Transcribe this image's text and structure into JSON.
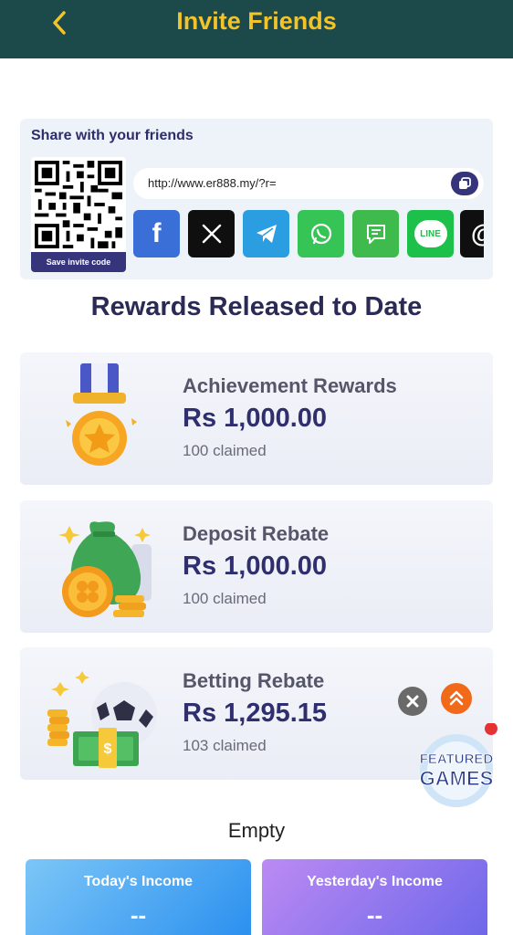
{
  "header": {
    "title": "Invite Friends"
  },
  "share": {
    "title": "Share with your friends",
    "save_label": "Save invite code",
    "invite_url": "http://www.er888.my/?r=",
    "platforms": [
      {
        "name": "Facebook",
        "glyph": "f",
        "color": "#3b6fd8"
      },
      {
        "name": "X",
        "glyph": "𝕏",
        "color": "#0f0f0f"
      },
      {
        "name": "Telegram",
        "glyph": "",
        "color": "#2a9ee0"
      },
      {
        "name": "WhatsApp",
        "glyph": "",
        "color": "#37c456"
      },
      {
        "name": "SMS",
        "glyph": "",
        "color": "#3fbb4d"
      },
      {
        "name": "LINE",
        "glyph": "LINE",
        "color": "#1cc04a"
      },
      {
        "name": "Threads",
        "glyph": "@",
        "color": "#0f0f0f"
      }
    ]
  },
  "rewards": {
    "section_title": "Rewards Released to Date",
    "items": [
      {
        "name": "Achievement Rewards",
        "amount": "Rs  1,000.00",
        "claimed": "100 claimed",
        "icon": "medal-icon"
      },
      {
        "name": "Deposit Rebate",
        "amount": "Rs  1,000.00",
        "claimed": "100 claimed",
        "icon": "money-bag-icon"
      },
      {
        "name": "Betting Rebate",
        "amount": "Rs  1,295.15",
        "claimed": "103 claimed",
        "icon": "soccer-cash-icon"
      }
    ]
  },
  "featured": {
    "label": "FEATURED GAMES"
  },
  "empty_label": "Empty",
  "income": {
    "today": {
      "title": "Today's Income",
      "value": "--"
    },
    "yesterday": {
      "title": "Yesterday's Income",
      "value": "--"
    }
  },
  "colors": {
    "header_bg": "#1c4a4a",
    "accent_gold": "#f3c32b",
    "brand_navy": "#2f2e6e",
    "today_gradient": [
      "#7cc6f7",
      "#2a8fef"
    ],
    "yesterday_gradient": [
      "#bc8af3",
      "#6c67e9"
    ]
  }
}
